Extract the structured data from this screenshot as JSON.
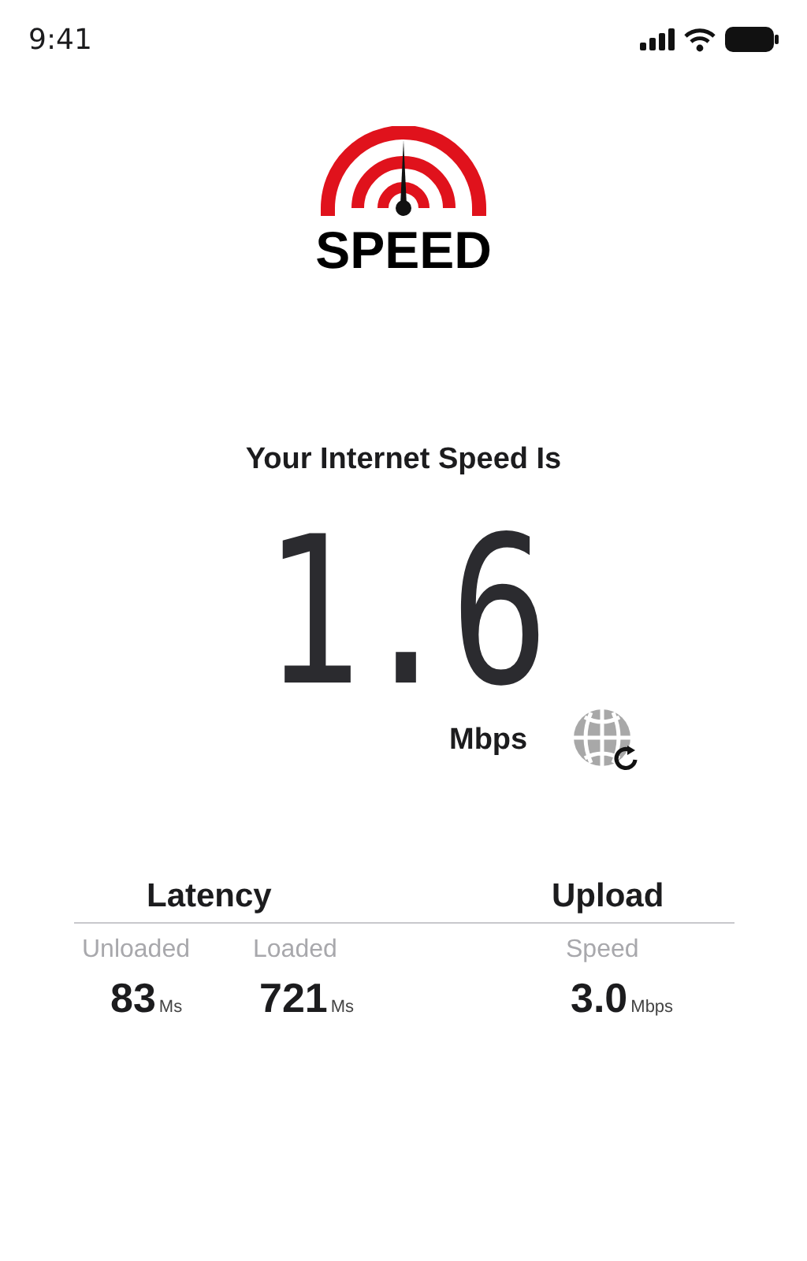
{
  "status_bar": {
    "time": "9:41"
  },
  "logo": {
    "text": "SPEED"
  },
  "heading": "Your Internet Speed Is",
  "speed": {
    "value": "1.6",
    "unit": "Mbps"
  },
  "latency": {
    "title": "Latency",
    "items": [
      {
        "label": "Unloaded",
        "value": "83",
        "unit": "Ms"
      },
      {
        "label": "Loaded",
        "value": "721",
        "unit": "Ms"
      }
    ]
  },
  "upload": {
    "title": "Upload",
    "items": [
      {
        "label": "Speed",
        "value": "3.0",
        "unit": "Mbps"
      }
    ]
  }
}
